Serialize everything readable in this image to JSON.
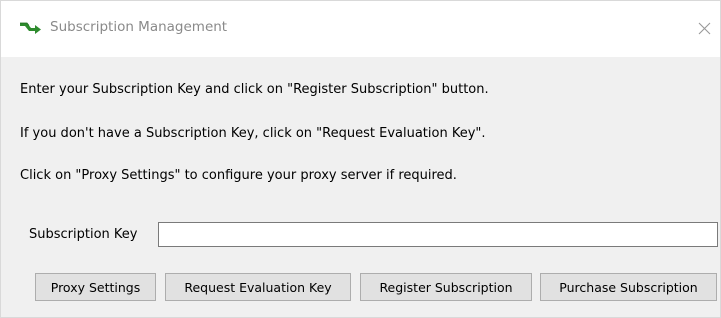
{
  "window": {
    "title": "Subscription Management",
    "icon": "green-arrow-icon",
    "close_icon": "close-icon"
  },
  "messages": [
    "Enter your Subscription Key and click on \"Register Subscription\" button.",
    "If you don't have a Subscription Key, click on \"Request Evaluation Key\".",
    "Click on \"Proxy Settings\" to configure your proxy server if required."
  ],
  "form": {
    "subscription_key_label": "Subscription Key",
    "subscription_key_value": ""
  },
  "buttons": {
    "proxy_settings": "Proxy Settings",
    "request_evaluation_key": "Request Evaluation Key",
    "register_subscription": "Register Subscription",
    "purchase_subscription": "Purchase Subscription"
  },
  "colors": {
    "icon_green": "#2e8b2e",
    "button_face": "#e1e1e1",
    "dialog_background": "#f0f0f0"
  }
}
